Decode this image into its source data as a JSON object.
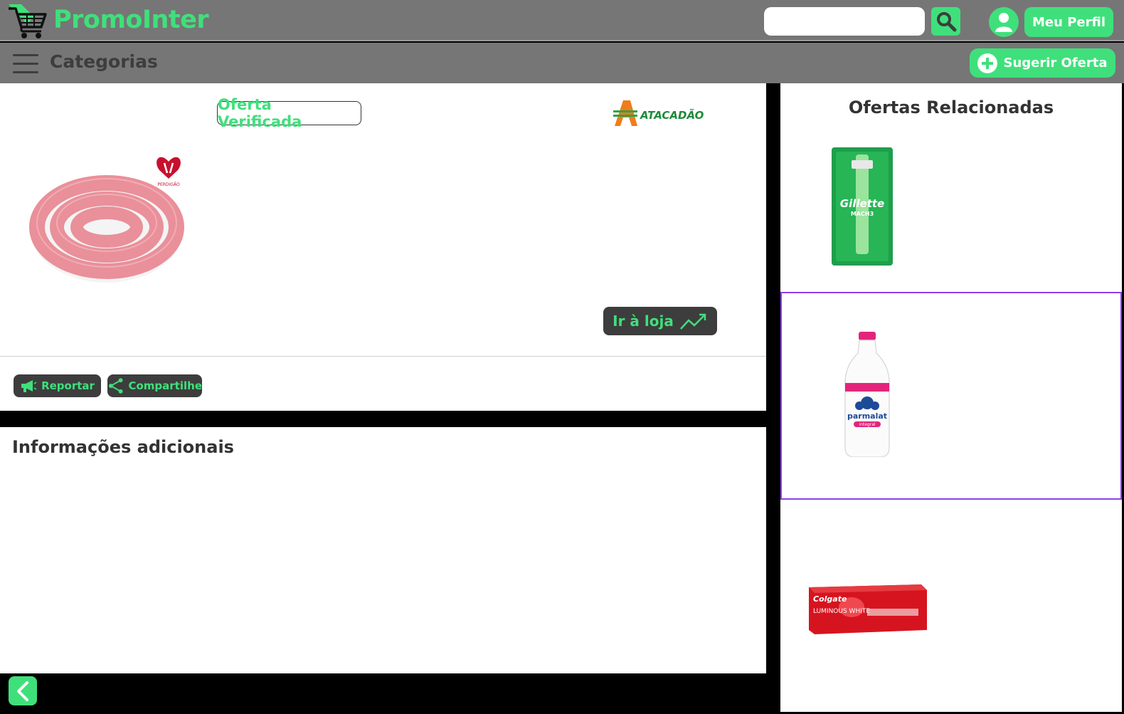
{
  "header": {
    "brand": "PromoInter",
    "search_placeholder": "",
    "profile_label": "Meu Perfil"
  },
  "catbar": {
    "categories_label": "Categorias",
    "suggest_label": "Sugerir Oferta"
  },
  "offer": {
    "verified_label": "Oferta Verificada",
    "store_name": "ATACADÃO",
    "brand_mark": "PERDIGÃO",
    "goto_label": "Ir à loja",
    "report_label": "Reportar",
    "share_label": "Compartilhe"
  },
  "info": {
    "title": "Informações adicionais"
  },
  "sidebar": {
    "title": "Ofertas Relacionadas",
    "items": [
      {
        "product": "Gillette Mach3 Sensitive",
        "brand_text": "Gillette",
        "sub_text": "MACH3"
      },
      {
        "product": "Parmalat integral",
        "brand_text": "parmalat",
        "sub_text": "integral",
        "selected": true
      },
      {
        "product": "Colgate Luminous White",
        "brand_text": "Colgate",
        "sub_text": "LUMINOUS WHITE"
      }
    ]
  },
  "colors": {
    "accent_green": "#3fe07b",
    "bar_gray": "#767676",
    "dark_button": "#3d3d3d",
    "selection_purple": "#8c3ff0"
  }
}
